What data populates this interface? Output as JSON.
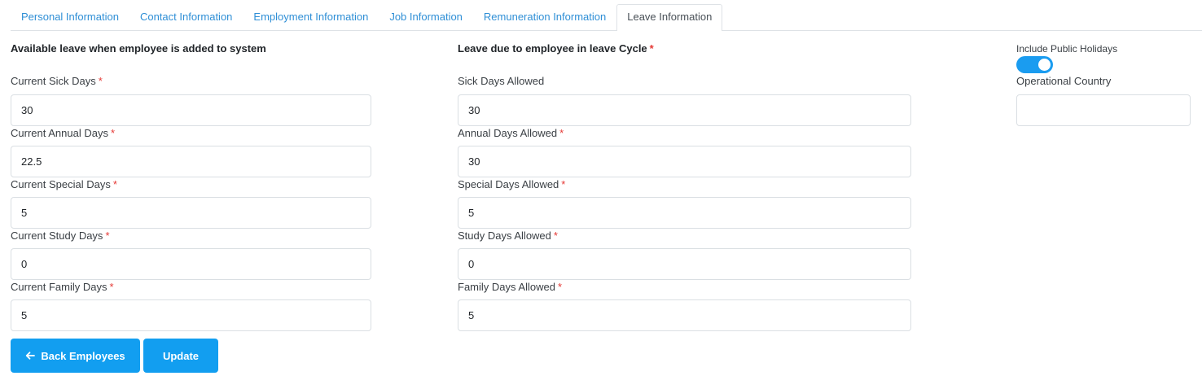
{
  "tabs": [
    {
      "label": "Personal Information",
      "active": false
    },
    {
      "label": "Contact Information",
      "active": false
    },
    {
      "label": "Employment Information",
      "active": false
    },
    {
      "label": "Job Information",
      "active": false
    },
    {
      "label": "Remuneration Information",
      "active": false
    },
    {
      "label": "Leave Information",
      "active": true
    }
  ],
  "left_section": {
    "heading": "Available leave when employee is added to system",
    "fields": [
      {
        "label": "Current Sick Days",
        "value": "30",
        "required": true
      },
      {
        "label": "Current Annual Days",
        "value": "22.5",
        "required": true
      },
      {
        "label": "Current Special Days",
        "value": "5",
        "required": true
      },
      {
        "label": "Current Study Days",
        "value": "0",
        "required": true
      },
      {
        "label": "Current Family Days",
        "value": "5",
        "required": true
      }
    ]
  },
  "middle_section": {
    "heading": "Leave due to employee in leave Cycle",
    "heading_required": true,
    "fields": [
      {
        "label": "Sick Days Allowed",
        "value": "30",
        "required": false
      },
      {
        "label": "Annual Days Allowed",
        "value": "30",
        "required": true
      },
      {
        "label": "Special Days Allowed",
        "value": "5",
        "required": true
      },
      {
        "label": "Study Days Allowed",
        "value": "0",
        "required": true
      },
      {
        "label": "Family Days Allowed",
        "value": "5",
        "required": true
      }
    ]
  },
  "right_section": {
    "public_holidays_label": "Include Public Holidays",
    "public_holidays_enabled": true,
    "operational_country_label": "Operational Country",
    "operational_country_value": ""
  },
  "required_marker": "*",
  "buttons": {
    "back_label": "Back Employees",
    "back_icon": "arrow-left-icon",
    "update_label": "Update"
  },
  "colors": {
    "accent": "#129ef0",
    "tab_link": "#2f8fd6",
    "required": "#e53935"
  }
}
